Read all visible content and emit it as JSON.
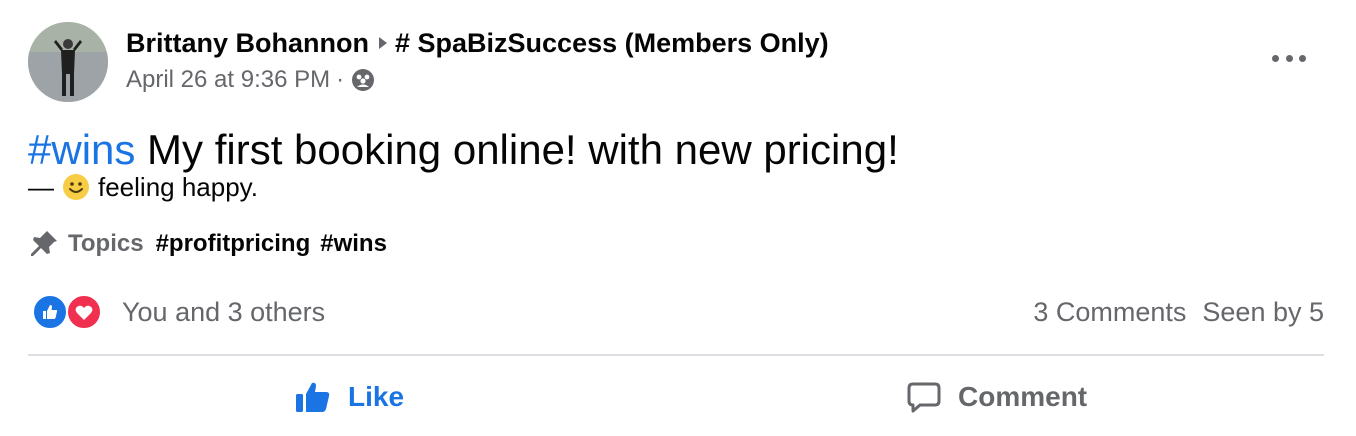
{
  "post": {
    "author": "Brittany Bohannon",
    "group": "# SpaBizSuccess (Members Only)",
    "timestamp": "April 26 at 9:36 PM",
    "separator": "·",
    "privacy_icon": "group-members-icon",
    "hashtag": "#wins",
    "text": " My first booking online! with new pricing!",
    "feeling_prefix": "—",
    "feeling_text": "feeling happy.",
    "feeling_icon": "smiley-icon"
  },
  "topics": {
    "label": "Topics",
    "tags": [
      "#profitpricing",
      "#wins"
    ],
    "icon": "pushpin-icon"
  },
  "engagement": {
    "reactions": [
      "like",
      "love"
    ],
    "reaction_text": "You and 3 others",
    "comments": "3 Comments",
    "seen": "Seen by 5"
  },
  "actions": {
    "like_label": "Like",
    "comment_label": "Comment"
  },
  "colors": {
    "accent": "#1b74e4",
    "love": "#f0304e",
    "secondary_text": "#65676b"
  }
}
